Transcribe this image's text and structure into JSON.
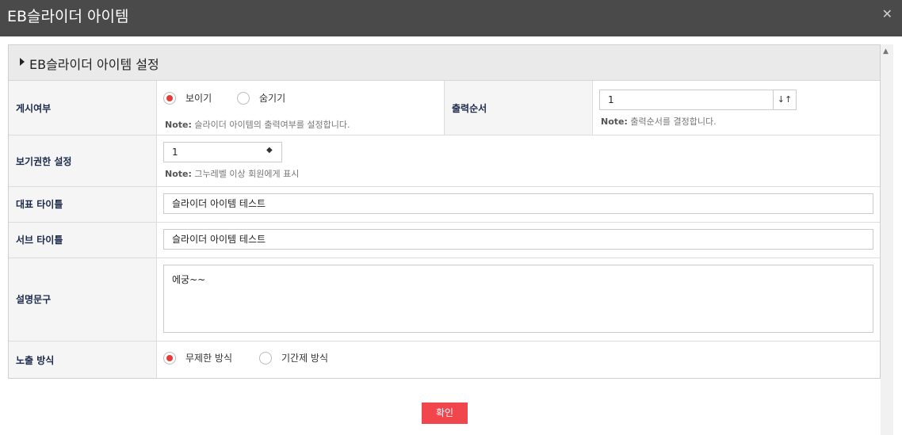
{
  "window": {
    "title": "EB슬라이더 아이템",
    "close_glyph": "✕"
  },
  "panel": {
    "title": "EB슬라이더 아이템 설정"
  },
  "rows": {
    "display": {
      "label": "게시여부",
      "options": [
        {
          "label": "보이기",
          "selected": true
        },
        {
          "label": "숨기기",
          "selected": false
        }
      ],
      "note_prefix": "Note:",
      "note_text": " 슬라이더 아이템의 출력여부를 설정합니다."
    },
    "order": {
      "label": "출력순서",
      "value": "1",
      "stepper_glyph": "↓↑",
      "note_prefix": "Note:",
      "note_text": " 출력순서를 결정합니다."
    },
    "permission": {
      "label": "보기권한 설정",
      "value": "1",
      "note_prefix": "Note:",
      "note_text": " 그누레벨 이상 회원에게 표시"
    },
    "main_title": {
      "label": "대표 타이틀",
      "value": "슬라이더 아이템 테스트"
    },
    "sub_title": {
      "label": "서브 타이틀",
      "value": "슬라이더 아이템 테스트"
    },
    "description": {
      "label": "설명문구",
      "value": "에궁~~"
    },
    "exposure": {
      "label": "노출 방식",
      "options": [
        {
          "label": "무제한 방식",
          "selected": true
        },
        {
          "label": "기간제 방식",
          "selected": false
        }
      ]
    }
  },
  "buttons": {
    "confirm": "확인"
  },
  "colors": {
    "accent": "#e43b3b",
    "button": "#f2464d",
    "titlebar": "#4a4a4a"
  }
}
